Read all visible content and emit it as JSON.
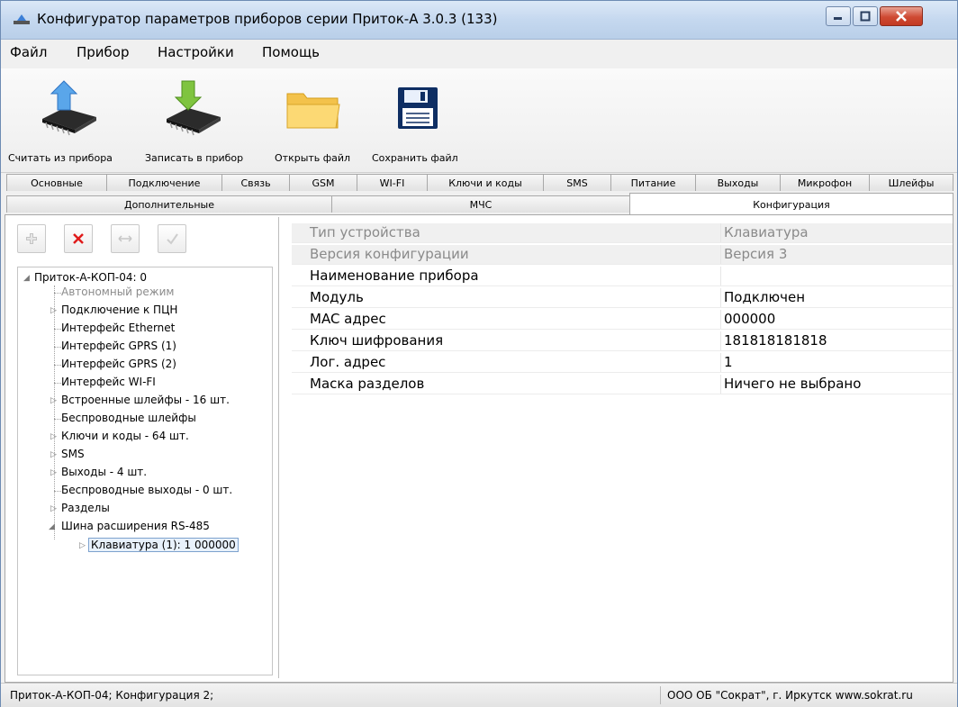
{
  "window": {
    "title": "Конфигуратор параметров приборов серии Приток-А   3.0.3 (133)"
  },
  "menu": [
    "Файл",
    "Прибор",
    "Настройки",
    "Помощь"
  ],
  "toolbar": {
    "read_label": "Считать из прибора",
    "write_label": "Записать в прибор",
    "open_label": "Открыть файл",
    "save_label": "Сохранить файл"
  },
  "tabs_row1": [
    "Основные",
    "Подключение",
    "Связь",
    "GSM",
    "WI-FI",
    "Ключи и коды",
    "SMS",
    "Питание",
    "Выходы",
    "Микрофон",
    "Шлейфы"
  ],
  "tabs_row2": [
    "Дополнительные",
    "МЧС",
    "Конфигурация"
  ],
  "active_tab": "Конфигурация",
  "tree": {
    "root": "Приток-А-КОП-04: 0",
    "items": [
      "Автономный режим",
      "Подключение к ПЦН",
      "Интерфейс Ethernet",
      "Интерфейс GPRS (1)",
      "Интерфейс GPRS (2)",
      "Интерфейс WI-FI",
      "Встроенные шлейфы - 16 шт.",
      "Беспроводные шлейфы",
      "Ключи и коды - 64 шт.",
      "SMS",
      "Выходы - 4 шт.",
      "Беспроводные выходы - 0 шт.",
      "Разделы",
      "Шина расширения RS-485"
    ],
    "child": "Клавиатура (1): 1 000000"
  },
  "properties": [
    {
      "key": "Тип устройства",
      "value": "Клавиатура"
    },
    {
      "key": "Версия конфигурации",
      "value": "Версия 3"
    },
    {
      "key": "Наименование прибора",
      "value": ""
    },
    {
      "key": "Модуль",
      "value": "Подключен"
    },
    {
      "key": "MAC адрес",
      "value": "000000"
    },
    {
      "key": "Ключ шифрования",
      "value": "181818181818"
    },
    {
      "key": "Лог. адрес",
      "value": "1"
    },
    {
      "key": "Маска разделов",
      "value": "Ничего не выбрано"
    }
  ],
  "status": {
    "left": "Приток-А-КОП-04; Конфигурация 2;",
    "right": "ООО ОБ \"Сократ\", г. Иркутск   www.sokrat.ru"
  }
}
